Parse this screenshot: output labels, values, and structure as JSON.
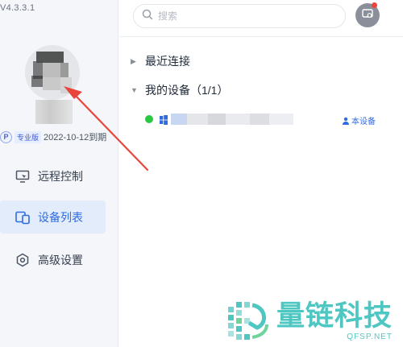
{
  "app": {
    "version": "V4.3.3.1"
  },
  "account": {
    "plan_icon_letter": "P",
    "plan_badge": "专业版",
    "expiry": "2022-10-12到期"
  },
  "sidebar": {
    "items": [
      {
        "label": "远程控制",
        "icon": "remote-monitor-icon",
        "active": false
      },
      {
        "label": "设备列表",
        "icon": "device-list-icon",
        "active": true
      },
      {
        "label": "高级设置",
        "icon": "hexagon-settings-icon",
        "active": false
      }
    ]
  },
  "header": {
    "search_placeholder": "搜索",
    "search_icon": "search-icon",
    "message_icon": "message-bell-icon",
    "has_notification": true
  },
  "devices": {
    "groups": [
      {
        "label": "最近连接",
        "expanded": false
      },
      {
        "label": "我的设备（1/1）",
        "expanded": true
      }
    ],
    "list": [
      {
        "status": "online",
        "os_icon": "windows-icon",
        "name_blurred": true,
        "tag": "本设备"
      }
    ]
  },
  "watermark": {
    "brand_cn": "量链科技",
    "brand_en": "QFSP.NET"
  },
  "colors": {
    "accent": "#2f6be0",
    "online": "#28c840",
    "annotation_arrow": "#e8453c",
    "watermark": "#4ec7c3"
  }
}
